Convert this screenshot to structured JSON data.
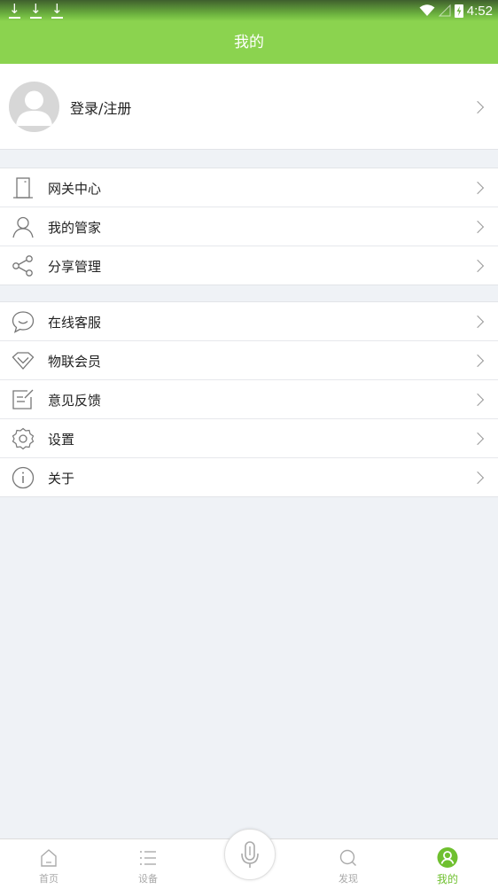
{
  "status_bar": {
    "time": "4:52",
    "download_icons": [
      "download-icon",
      "download-icon",
      "download-icon"
    ]
  },
  "header": {
    "title": "我的"
  },
  "profile": {
    "label": "登录/注册"
  },
  "menu_group_1": [
    {
      "label": "网关中心",
      "icon": "gateway-icon"
    },
    {
      "label": "我的管家",
      "icon": "person-icon"
    },
    {
      "label": "分享管理",
      "icon": "share-icon"
    }
  ],
  "menu_group_2": [
    {
      "label": "在线客服",
      "icon": "chat-bubble-icon"
    },
    {
      "label": "物联会员",
      "icon": "diamond-icon"
    },
    {
      "label": "意见反馈",
      "icon": "feedback-icon"
    },
    {
      "label": "设置",
      "icon": "gear-icon"
    },
    {
      "label": "关于",
      "icon": "info-icon"
    }
  ],
  "tabs": [
    {
      "label": "首页",
      "icon": "home-icon",
      "active": false
    },
    {
      "label": "设备",
      "icon": "list-icon",
      "active": false
    },
    {
      "label": "发现",
      "icon": "search-icon",
      "active": false
    },
    {
      "label": "我的",
      "icon": "profile-icon",
      "active": true
    }
  ],
  "colors": {
    "accent": "#8bd34f",
    "active_tab": "#6fc02f",
    "background": "#eff2f6"
  }
}
